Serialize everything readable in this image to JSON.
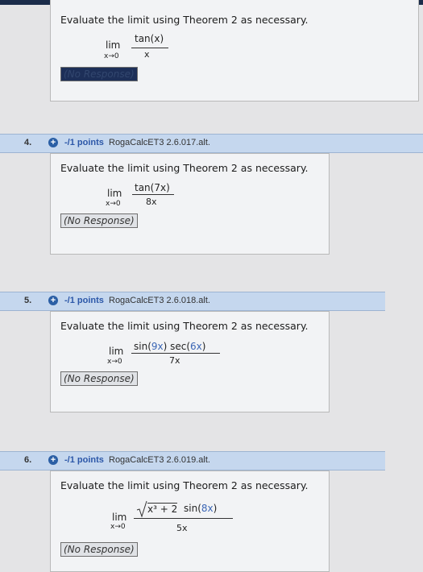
{
  "prompt": "Evaluate the limit using Theorem 2 as necessary.",
  "response_label": "(No Response)",
  "questions": [
    {
      "number": "4.",
      "points": "-/1 points",
      "source": "RogaCalcET3 2.6.017.alt.",
      "limit": {
        "lim": "lim",
        "sub": "x→0",
        "num": "tan(7x)",
        "den": "8x"
      }
    },
    {
      "number": "5.",
      "points": "-/1 points",
      "source": "RogaCalcET3 2.6.018.alt.",
      "limit": {
        "lim": "lim",
        "sub": "x→0",
        "num_a": "sin(",
        "num_b": "9x",
        "num_c": ") sec(",
        "num_d": "6x",
        "num_e": ")",
        "den": "7x"
      }
    },
    {
      "number": "6.",
      "points": "-/1 points",
      "source": "RogaCalcET3 2.6.019.alt.",
      "limit": {
        "lim": "lim",
        "sub": "x→0",
        "radicand": "x³ + 2",
        "num_b": " sin(",
        "num_c": "8x",
        "num_d": ")",
        "den": "5x"
      }
    }
  ],
  "previous": {
    "limit": {
      "lim": "lim",
      "sub": "x→0",
      "num": "tan(x)",
      "den": "x"
    }
  }
}
